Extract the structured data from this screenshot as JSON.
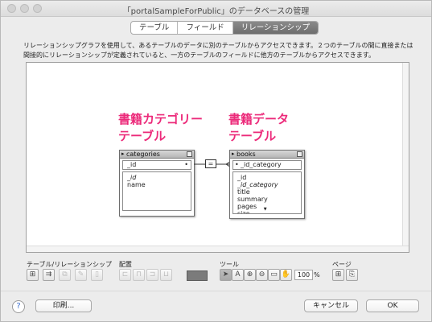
{
  "window": {
    "title": "「portalSampleForPublic」のデータベースの管理"
  },
  "tabs": [
    {
      "label": "テーブル"
    },
    {
      "label": "フィールド"
    },
    {
      "label": "リレーションシップ",
      "active": true
    }
  ],
  "description": "リレーションシップグラフを使用して、あるテーブルのデータに別のテーブルからアクセスできます。２つのテーブルの間に直接または間接的にリレーションシップが定義されていると、一方のテーブルのフィールドに他方のテーブルからアクセスできます。",
  "annotations": {
    "left_line1": "書籍カテゴリー",
    "left_line2": "テーブル",
    "right_line1": "書籍データ",
    "right_line2": "テーブル",
    "color": "#ec2a7a"
  },
  "tables": {
    "categories": {
      "name": "categories",
      "key_field": "_id",
      "fields": [
        {
          "label": "_id",
          "italic": true
        },
        {
          "label": "name",
          "italic": false
        }
      ]
    },
    "books": {
      "name": "books",
      "key_field": "_id_category",
      "fields": [
        {
          "label": "_id",
          "italic": false
        },
        {
          "label": "_id_category",
          "italic": true
        },
        {
          "label": "title",
          "italic": false
        },
        {
          "label": "summary",
          "italic": false
        },
        {
          "label": "pages",
          "italic": false
        },
        {
          "label": "size",
          "italic": false
        }
      ]
    }
  },
  "relationship": {
    "operator": "="
  },
  "toolbar": {
    "section_table": "テーブル/リレーションシップ",
    "section_arrange": "配置",
    "section_tools": "ツール",
    "section_page": "ページ",
    "zoom_value": "100",
    "zoom_unit": "%",
    "swatch_color": "#7b7b7b"
  },
  "icons": {
    "add_table": "add-table-icon",
    "add_relationship": "add-relationship-icon",
    "duplicate": "duplicate-icon",
    "edit": "pencil-icon",
    "delete": "trash-icon",
    "select": "pointer-icon",
    "text": "text-icon",
    "zoom_in": "zoom-in-icon",
    "zoom_out": "zoom-out-icon",
    "fit": "fit-window-icon",
    "hand": "hand-icon",
    "page_break": "page-break-icon",
    "page_setup": "page-setup-icon"
  },
  "footer": {
    "help": "?",
    "print": "印刷...",
    "cancel": "キャンセル",
    "ok": "OK"
  }
}
